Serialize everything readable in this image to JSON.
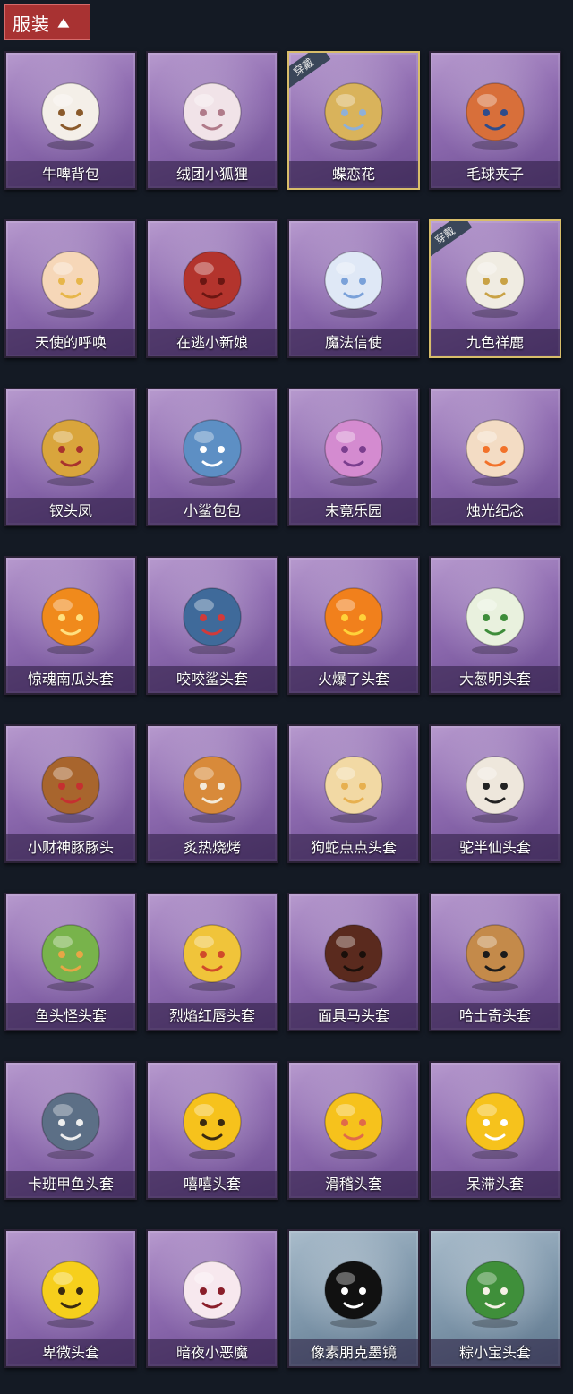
{
  "header": {
    "label": "服装",
    "chevron_icon": "chevron-up-icon"
  },
  "worn_tag": "穿戴",
  "items": [
    {
      "name": "牛啤背包",
      "icon": "cow-beer-icon",
      "color": "#f4efe8",
      "accent": "#8a5a2b",
      "worn": false,
      "bg": "purple"
    },
    {
      "name": "绒团小狐狸",
      "icon": "fox-icon",
      "color": "#f1e3e8",
      "accent": "#b07b8a",
      "worn": false,
      "bg": "purple"
    },
    {
      "name": "蝶恋花",
      "icon": "bell-wreath-icon",
      "color": "#d9b35b",
      "accent": "#8fb0d8",
      "worn": true,
      "bg": "purple"
    },
    {
      "name": "毛球夹子",
      "icon": "raccoon-drum-icon",
      "color": "#d86f3a",
      "accent": "#2e4c8c",
      "worn": false,
      "bg": "purple"
    },
    {
      "name": "天使的呼唤",
      "icon": "angel-icon",
      "color": "#f6d7b8",
      "accent": "#e7b64a",
      "worn": false,
      "bg": "purple"
    },
    {
      "name": "在逃小新娘",
      "icon": "mushroom-icon",
      "color": "#b3342d",
      "accent": "#6b1612",
      "worn": false,
      "bg": "purple"
    },
    {
      "name": "魔法信使",
      "icon": "elephant-icon",
      "color": "#dfe8f6",
      "accent": "#7aa1d9",
      "worn": false,
      "bg": "purple"
    },
    {
      "name": "九色祥鹿",
      "icon": "deer-icon",
      "color": "#f0ece2",
      "accent": "#c9a245",
      "worn": true,
      "bg": "purple"
    },
    {
      "name": "钗头凤",
      "icon": "phoenix-crown-icon",
      "color": "#d9a53c",
      "accent": "#a8322d",
      "worn": false,
      "bg": "purple"
    },
    {
      "name": "小鲨包包",
      "icon": "shark-bag-icon",
      "color": "#5d8fc4",
      "accent": "#ffffff",
      "worn": false,
      "bg": "purple"
    },
    {
      "name": "未竟乐园",
      "icon": "doll-icon",
      "color": "#d48bd0",
      "accent": "#7a3e8e",
      "worn": false,
      "bg": "purple"
    },
    {
      "name": "烛光纪念",
      "icon": "candle-icon",
      "color": "#f3dcc4",
      "accent": "#f2722a",
      "worn": false,
      "bg": "purple"
    },
    {
      "name": "惊魂南瓜头套",
      "icon": "pumpkin-icon",
      "color": "#f08a1c",
      "accent": "#ffe080",
      "worn": false,
      "bg": "purple"
    },
    {
      "name": "咬咬鲨头套",
      "icon": "shark-head-icon",
      "color": "#3f6a9a",
      "accent": "#d23a3a",
      "worn": false,
      "bg": "purple"
    },
    {
      "name": "火爆了头套",
      "icon": "fire-face-icon",
      "color": "#f1801c",
      "accent": "#ffd23a",
      "worn": false,
      "bg": "purple"
    },
    {
      "name": "大葱明头套",
      "icon": "scallion-icon",
      "color": "#e9f1de",
      "accent": "#3e8d3a",
      "worn": false,
      "bg": "purple"
    },
    {
      "name": "小财神豚豚头",
      "icon": "capybara-icon",
      "color": "#a8652d",
      "accent": "#c53030",
      "worn": false,
      "bg": "purple"
    },
    {
      "name": "炙热烧烤",
      "icon": "grill-meat-icon",
      "color": "#d88a3a",
      "accent": "#f4ead8",
      "worn": false,
      "bg": "purple"
    },
    {
      "name": "狗蛇点点头套",
      "icon": "snake-head-icon",
      "color": "#f2d9a4",
      "accent": "#e7b04f",
      "worn": false,
      "bg": "purple"
    },
    {
      "name": "驼半仙头套",
      "icon": "bear-glasses-icon",
      "color": "#eee7dc",
      "accent": "#222222",
      "worn": false,
      "bg": "purple"
    },
    {
      "name": "鱼头怪头套",
      "icon": "fish-head-icon",
      "color": "#78b34b",
      "accent": "#e7a646",
      "worn": false,
      "bg": "purple"
    },
    {
      "name": "烈焰红唇头套",
      "icon": "yellow-mouse-icon",
      "color": "#f0c43a",
      "accent": "#d04a2a",
      "worn": false,
      "bg": "purple"
    },
    {
      "name": "面具马头套",
      "icon": "horse-head-icon",
      "color": "#5a2a1e",
      "accent": "#1a0f0a",
      "worn": false,
      "bg": "purple"
    },
    {
      "name": "哈士奇头套",
      "icon": "husky-head-icon",
      "color": "#c48a4a",
      "accent": "#1b1b1b",
      "worn": false,
      "bg": "purple"
    },
    {
      "name": "卡班甲鱼头套",
      "icon": "whale-icon",
      "color": "#5c6f86",
      "accent": "#eeeeee",
      "worn": false,
      "bg": "purple"
    },
    {
      "name": "嘻嘻头套",
      "icon": "grin-face-icon",
      "color": "#f6c21c",
      "accent": "#3a2a10",
      "worn": false,
      "bg": "purple"
    },
    {
      "name": "滑稽头套",
      "icon": "funny-face-icon",
      "color": "#f6c21c",
      "accent": "#e06a4a",
      "worn": false,
      "bg": "purple"
    },
    {
      "name": "呆滞头套",
      "icon": "dazed-face-icon",
      "color": "#f6c21c",
      "accent": "#ffffff",
      "worn": false,
      "bg": "purple"
    },
    {
      "name": "卑微头套",
      "icon": "humble-face-icon",
      "color": "#f6cf1c",
      "accent": "#3a2a10",
      "worn": false,
      "bg": "purple"
    },
    {
      "name": "暗夜小恶魔",
      "icon": "devil-icon",
      "color": "#f7e8ee",
      "accent": "#8a1e2a",
      "worn": false,
      "bg": "purple"
    },
    {
      "name": "像素朋克墨镜",
      "icon": "pixel-glasses-icon",
      "color": "#111111",
      "accent": "#ffffff",
      "worn": false,
      "bg": "blue"
    },
    {
      "name": "粽小宝头套",
      "icon": "zongzi-icon",
      "color": "#3f8f3a",
      "accent": "#f6f1e6",
      "worn": false,
      "bg": "blue"
    }
  ]
}
